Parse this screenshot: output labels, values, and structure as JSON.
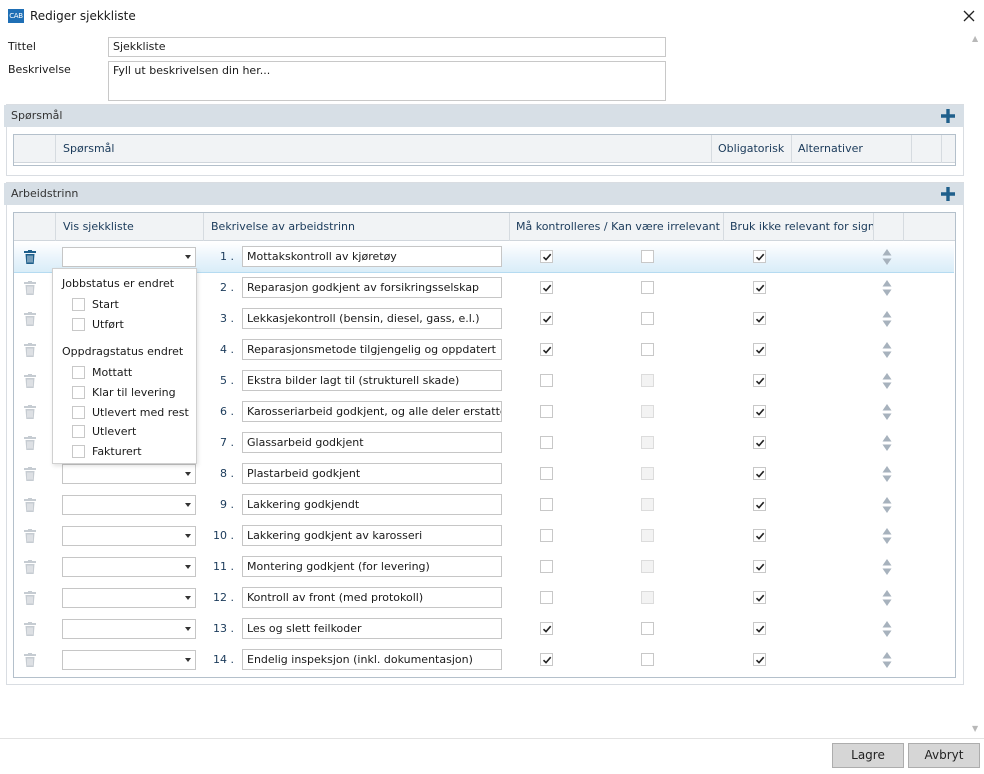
{
  "window": {
    "title": "Rediger sjekkliste",
    "app_icon_text": "CAB"
  },
  "form": {
    "title_label": "Tittel",
    "title_value": "Sjekkliste",
    "description_label": "Beskrivelse",
    "description_value": "Fyll ut beskrivelsen din her..."
  },
  "questions": {
    "header": "Spørsmål",
    "columns": [
      "Spørsmål",
      "Obligatorisk",
      "Alternativer"
    ]
  },
  "steps": {
    "header": "Arbeidstrinn",
    "columns": [
      "Vis sjekkliste",
      "Bekrivelse av arbeidstrinn",
      "Må kontrolleres / Kan være irrelevant",
      "Bruk ikke relevant for sign"
    ],
    "rows": [
      {
        "num": "1 .",
        "desc": "Mottakskontroll av kjøretøy",
        "check": true,
        "irrelevant": false,
        "irr_enabled": true,
        "sign": true
      },
      {
        "num": "2 .",
        "desc": "Reparasjon godkjent av forsikringsselskap",
        "check": true,
        "irrelevant": false,
        "irr_enabled": true,
        "sign": true
      },
      {
        "num": "3 .",
        "desc": "Lekkasjekontroll (bensin, diesel, gass, e.l.)",
        "check": true,
        "irrelevant": false,
        "irr_enabled": true,
        "sign": true
      },
      {
        "num": "4 .",
        "desc": "Reparasjonsmetode tilgjengelig og oppdatert",
        "check": true,
        "irrelevant": false,
        "irr_enabled": true,
        "sign": true
      },
      {
        "num": "5 .",
        "desc": "Ekstra bilder lagt til (strukturell skade)",
        "check": false,
        "irrelevant": false,
        "irr_enabled": false,
        "sign": true
      },
      {
        "num": "6 .",
        "desc": "Karosseriarbeid godkjent, og alle deler erstattet",
        "check": false,
        "irrelevant": false,
        "irr_enabled": false,
        "sign": true
      },
      {
        "num": "7 .",
        "desc": "Glassarbeid godkjent",
        "check": false,
        "irrelevant": false,
        "irr_enabled": false,
        "sign": true
      },
      {
        "num": "8 .",
        "desc": "Plastarbeid godkjent",
        "check": false,
        "irrelevant": false,
        "irr_enabled": false,
        "sign": true
      },
      {
        "num": "9 .",
        "desc": "Lakkering godkjendt",
        "check": false,
        "irrelevant": false,
        "irr_enabled": false,
        "sign": true
      },
      {
        "num": "10 .",
        "desc": "Lakkering godkjent av karosseri",
        "check": false,
        "irrelevant": false,
        "irr_enabled": false,
        "sign": true
      },
      {
        "num": "11 .",
        "desc": "Montering godkjent (for levering)",
        "check": false,
        "irrelevant": false,
        "irr_enabled": false,
        "sign": true
      },
      {
        "num": "12 .",
        "desc": "Kontroll av front (med protokoll)",
        "check": false,
        "irrelevant": false,
        "irr_enabled": false,
        "sign": true
      },
      {
        "num": "13 .",
        "desc": "Les og slett feilkoder",
        "check": true,
        "irrelevant": false,
        "irr_enabled": true,
        "sign": true
      },
      {
        "num": "14 .",
        "desc": "Endelig inspeksjon (inkl. dokumentasjon)",
        "check": true,
        "irrelevant": false,
        "irr_enabled": true,
        "sign": true
      }
    ]
  },
  "dropdown_popup": {
    "groups": [
      {
        "label": "Jobbstatus er endret",
        "options": [
          "Start",
          "Utført"
        ]
      },
      {
        "label": "Oppdragstatus endret",
        "options": [
          "Mottatt",
          "Klar til levering",
          "Utlevert med rest",
          "Utlevert",
          "Fakturert"
        ]
      }
    ]
  },
  "buttons": {
    "save": "Lagre",
    "cancel": "Avbryt"
  },
  "colors": {
    "accent": "#1f5f8b",
    "section_header": "#d7dfe6",
    "selected_row": "#e7f3fb"
  }
}
